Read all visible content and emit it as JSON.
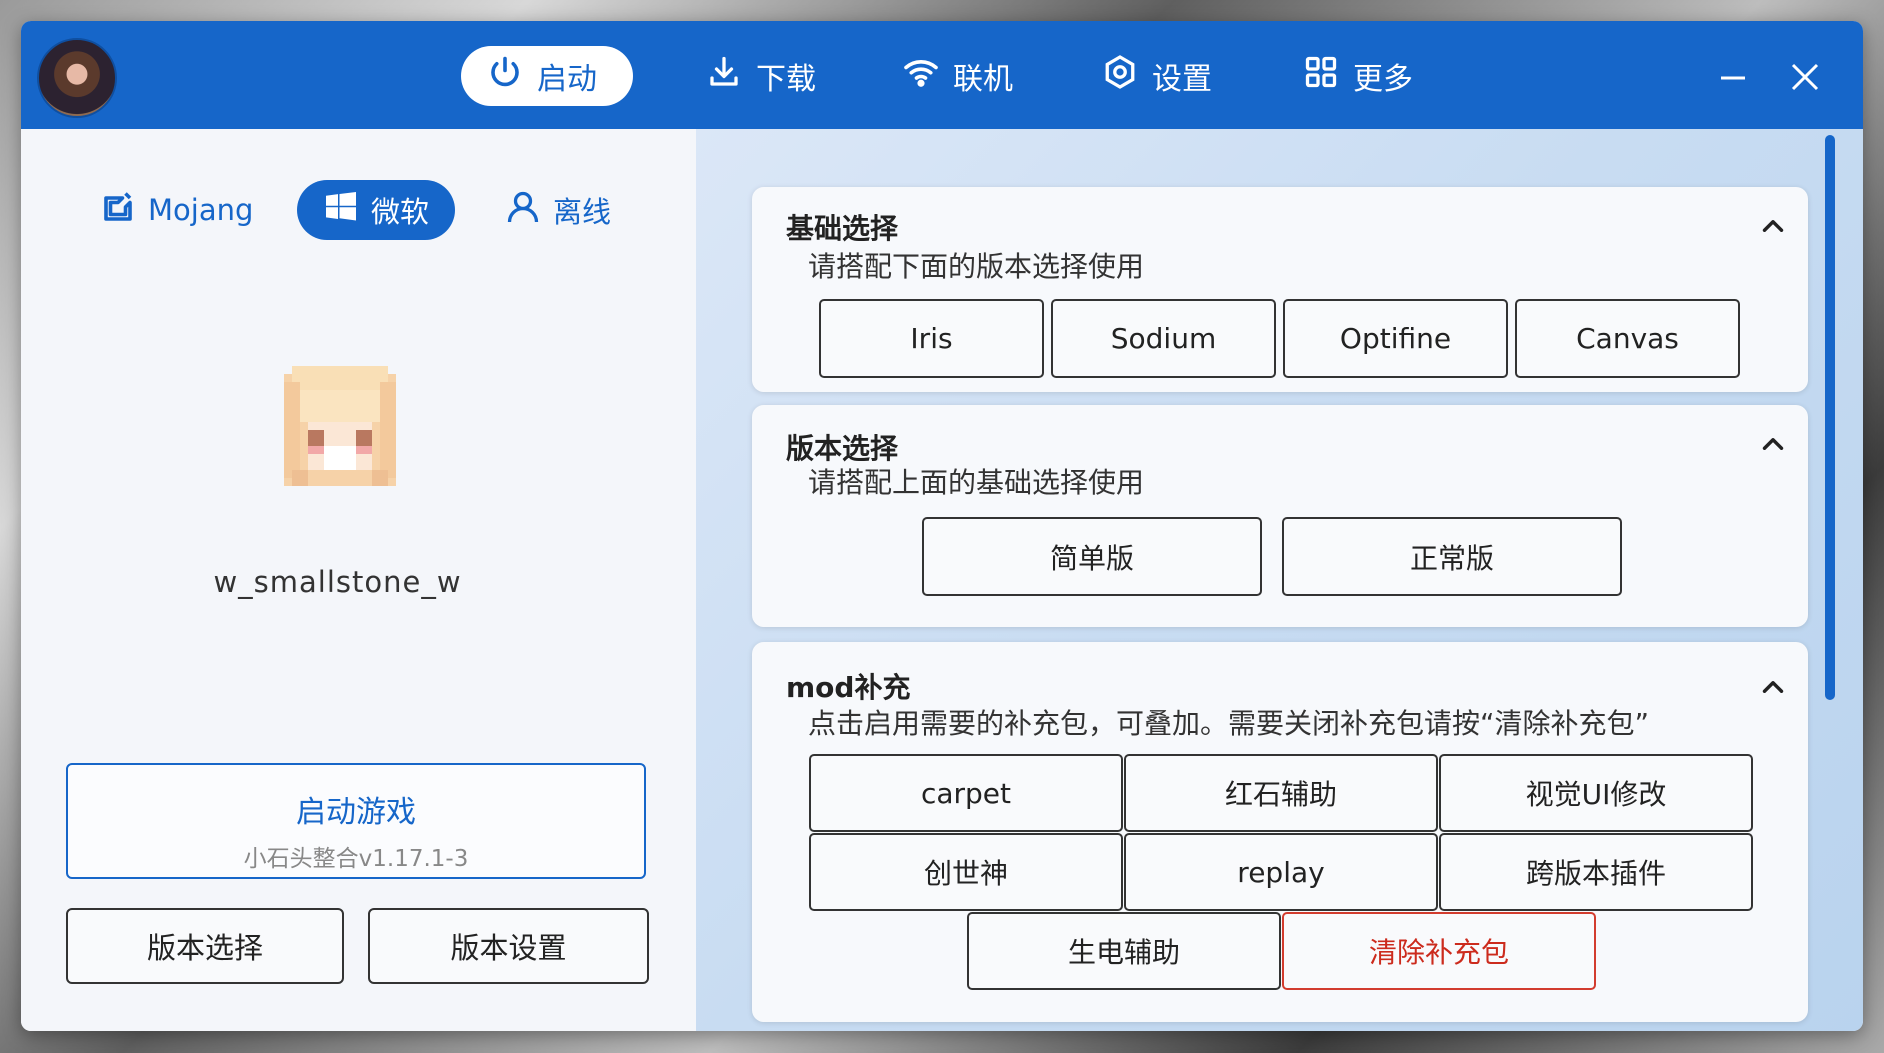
{
  "nav": {
    "launch": "启动",
    "download": "下载",
    "online": "联机",
    "settings": "设置",
    "more": "更多"
  },
  "account": {
    "mojang": "Mojang",
    "microsoft": "微软",
    "offline": "离线"
  },
  "player": {
    "name": "w_smallstone_w"
  },
  "launch": {
    "title": "启动游戏",
    "subtitle": "小石头整合v1.17.1-3"
  },
  "left_buttons": {
    "version_select": "版本选择",
    "version_settings": "版本设置"
  },
  "sections": {
    "basic": {
      "title": "基础选择",
      "subtitle": "请搭配下面的版本选择使用",
      "options": [
        "Iris",
        "Sodium",
        "Optifine",
        "Canvas"
      ]
    },
    "version": {
      "title": "版本选择",
      "subtitle": "请搭配上面的基础选择使用",
      "options": [
        "简单版",
        "正常版"
      ]
    },
    "mod": {
      "title": "mod补充",
      "subtitle": "点击启用需要的补充包，可叠加。需要关闭补充包请按“清除补充包”",
      "options": [
        "carpet",
        "红石辅助",
        "视觉UI修改",
        "创世神",
        "replay",
        "跨版本插件",
        "生电辅助"
      ],
      "clear": "清除补充包"
    }
  },
  "colors": {
    "accent": "#1666c9",
    "danger": "#cc2b1d",
    "titlebar": "#1666c9"
  }
}
